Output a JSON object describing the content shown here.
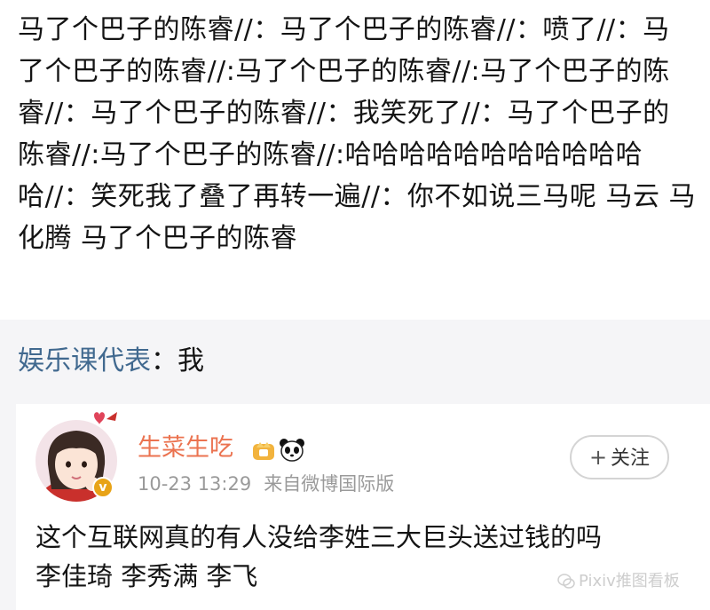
{
  "comment": {
    "text": "马了个巴子的陈睿//：马了个巴子的陈睿//：喷了//：马了个巴子的陈睿//:马了个巴子的陈睿//:马了个巴子的陈睿//：马了个巴子的陈睿//：我笑死了//：马了个巴子的陈睿//:马了个巴子的陈睿//:哈哈哈哈哈哈哈哈哈哈哈哈//：笑死我了叠了再转一遍//：你不如说三马呢 马云 马化腾 马了个巴子的陈睿"
  },
  "repost": {
    "user": "娱乐课代表",
    "separator": "：",
    "text": "我"
  },
  "card": {
    "username": "生菜生吃",
    "time": "10-23 13:29",
    "source": "来自微博国际版",
    "follow_plus": "+",
    "follow_label": "关注",
    "verify_mark": "v",
    "post_line1": "这个互联网真的有人没给李姓三大巨头送过钱的吗",
    "post_line2": "李佳琦 李秀满 李飞"
  },
  "watermark": {
    "text": "Pixiv推图看板",
    "icon": "wechat-icon"
  },
  "colors": {
    "username": "#eb7350",
    "repost_user": "#41698f",
    "meta": "#9a9a9a",
    "repost_background": "#f5f5f7"
  }
}
